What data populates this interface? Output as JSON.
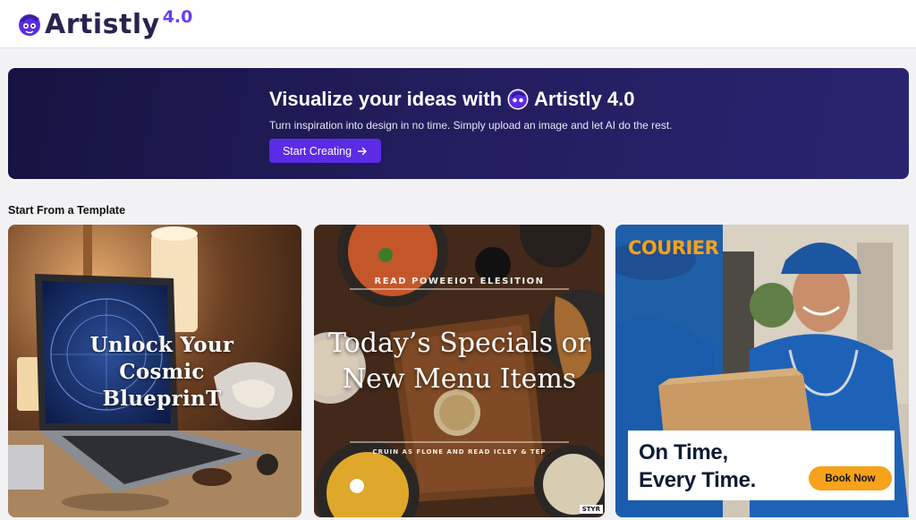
{
  "app": {
    "name": "Artistly",
    "version": "4.0"
  },
  "hero": {
    "title_prefix": "Visualize your ideas with",
    "title_brand": "Artistly 4.0",
    "subtitle": "Turn inspiration into design in no time. Simply upload an image and let AI do the rest.",
    "cta_label": "Start Creating",
    "cta_icon": "arrow-right-icon"
  },
  "templates": {
    "section_title": "Start From a Template",
    "cards": [
      {
        "title_lines": [
          "Unlock Your",
          "Cosmic",
          "BlueprinT"
        ]
      },
      {
        "top_text": "READ POWEEIOT ELESITION",
        "title_lines": [
          "Today’s Specials or",
          "New Menu Items"
        ],
        "bottom_text": "CRUIN AS FLONE AND READ ICLEY & TEP",
        "badge": "STYR"
      },
      {
        "brand": "COURIER",
        "headline_lines": [
          "On Time,",
          "Every Time."
        ],
        "button_label": "Book Now"
      }
    ]
  },
  "colors": {
    "accent": "#5b2be6",
    "hero_bg": "#1c1850",
    "courier_orange": "#f7a21b"
  }
}
